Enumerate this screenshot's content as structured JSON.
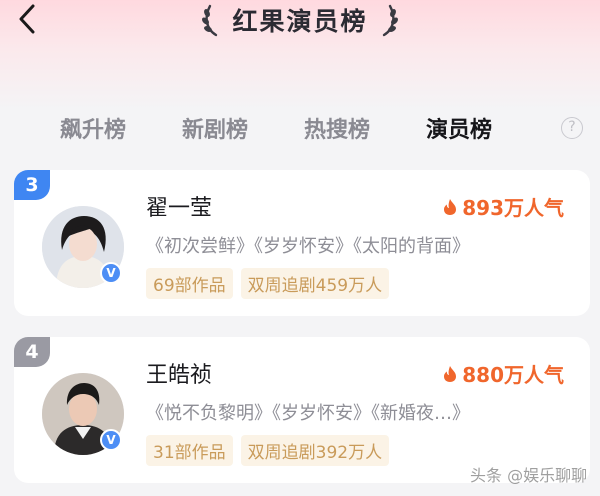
{
  "header": {
    "title": "红果演员榜"
  },
  "tabs": [
    {
      "label": "飙升榜",
      "active": false
    },
    {
      "label": "新剧榜",
      "active": false
    },
    {
      "label": "热搜榜",
      "active": false
    },
    {
      "label": "演员榜",
      "active": true
    }
  ],
  "help_label": "?",
  "actors": [
    {
      "rank": "3",
      "rank_color": "#3f86f2",
      "name": "翟一莹",
      "popularity": "893万人气",
      "works": "《初次尝鲜》《岁岁怀安》《太阳的背面》",
      "tags": [
        "69部作品",
        "双周追剧459万人"
      ],
      "verified": "V"
    },
    {
      "rank": "4",
      "rank_color": "#9a9aa3",
      "name": "王皓祯",
      "popularity": "880万人气",
      "works": "《悦不负黎明》《岁岁怀安》《新婚夜…》",
      "tags": [
        "31部作品",
        "双周追剧392万人"
      ],
      "verified": "V"
    }
  ],
  "watermark": "头条 @娱乐聊聊",
  "colors": {
    "accent_orange": "#f0662c",
    "tag_bg": "#fbf3e6",
    "tag_text": "#c99b5a",
    "verified_blue": "#4d8ef5"
  }
}
